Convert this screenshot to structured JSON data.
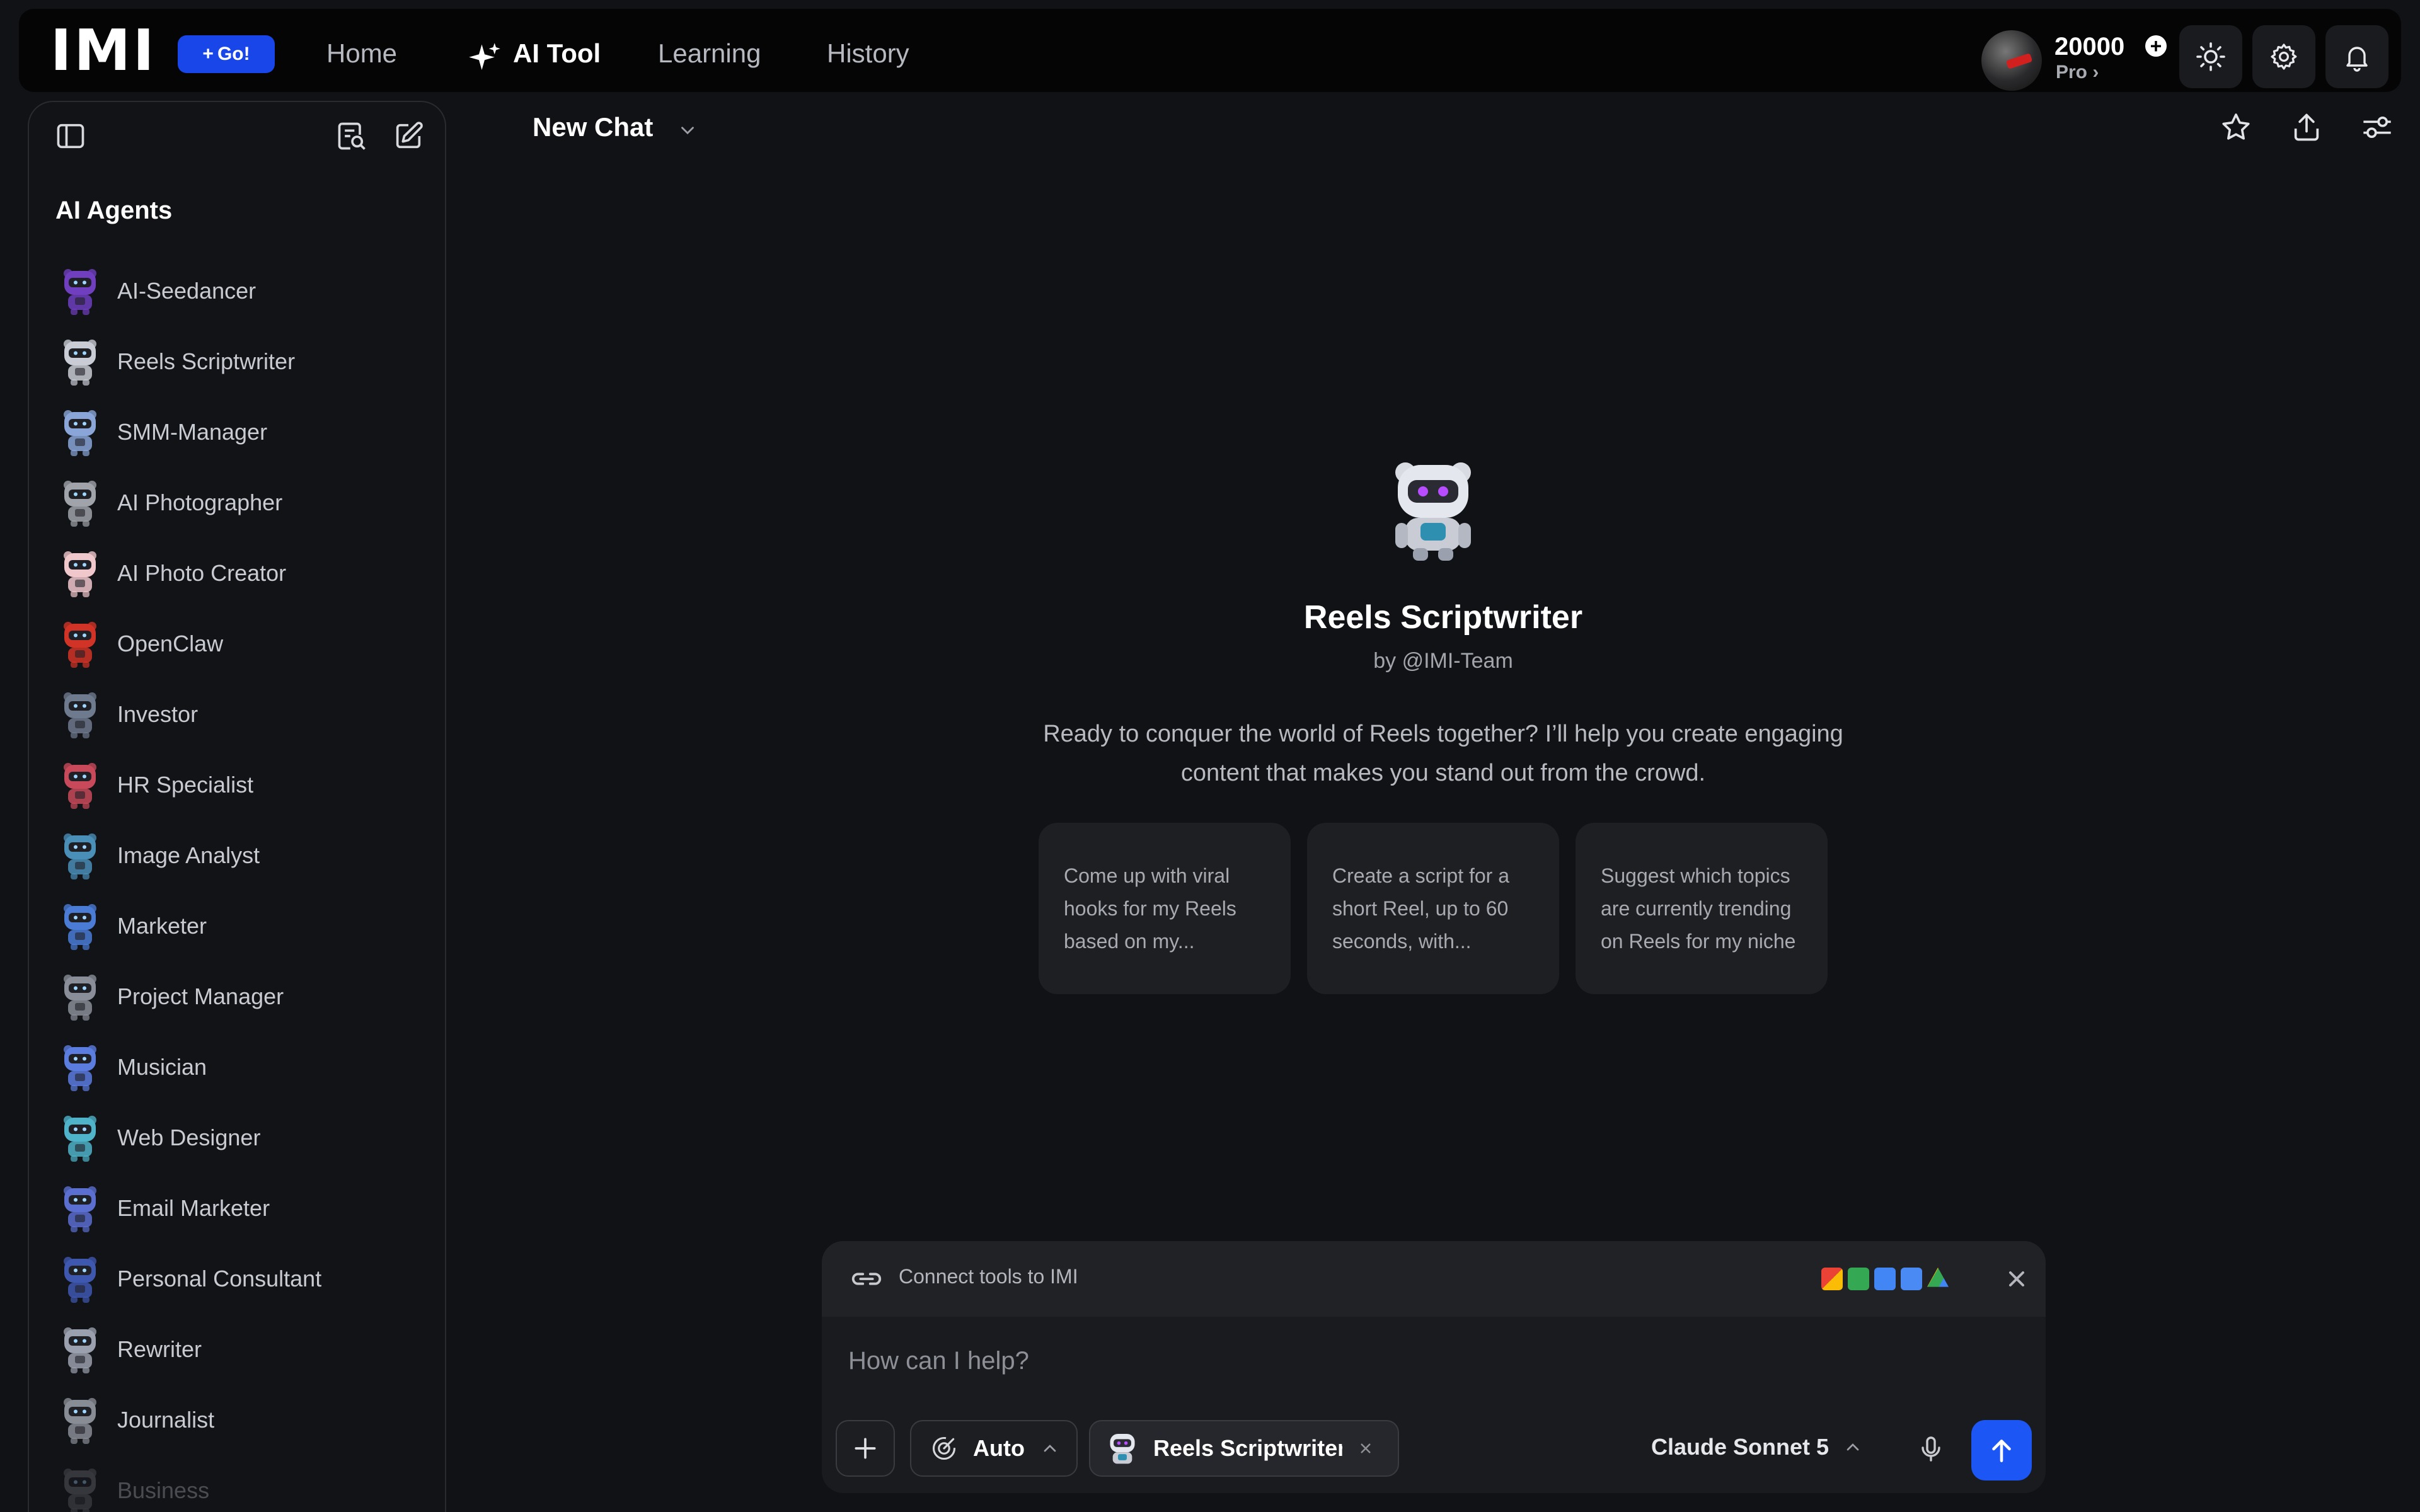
{
  "topbar": {
    "logo": "IMI",
    "go_badge": "Go!",
    "nav": [
      {
        "label": "Home"
      },
      {
        "label": "AI Tool"
      },
      {
        "label": "Learning"
      },
      {
        "label": "History"
      }
    ],
    "credits": {
      "amount": "20000",
      "plan": "Pro ›"
    },
    "icons": [
      "sun-icon",
      "gear-icon",
      "bell-icon"
    ]
  },
  "sidebar": {
    "heading": "AI Agents",
    "agents": [
      {
        "label": "AI-Seedancer",
        "color": "#6f3fbf"
      },
      {
        "label": "Reels Scriptwriter",
        "color": "#c9ccd4"
      },
      {
        "label": "SMM-Manager",
        "color": "#8aa6d8"
      },
      {
        "label": "AI Photographer",
        "color": "#a0a4aa"
      },
      {
        "label": "AI Photo Creator",
        "color": "#f0c8cc"
      },
      {
        "label": "OpenClaw",
        "color": "#d13427"
      },
      {
        "label": "Investor",
        "color": "#6e7a8e"
      },
      {
        "label": "HR Specialist",
        "color": "#c84a5a"
      },
      {
        "label": "Image Analyst",
        "color": "#4a8fb8"
      },
      {
        "label": "Marketer",
        "color": "#4a7cd6"
      },
      {
        "label": "Project Manager",
        "color": "#8a8e98"
      },
      {
        "label": "Musician",
        "color": "#5b7de0"
      },
      {
        "label": "Web Designer",
        "color": "#4fb3c9"
      },
      {
        "label": "Email Marketer",
        "color": "#5a6fd0"
      },
      {
        "label": "Personal Consultant",
        "color": "#3e58b0"
      },
      {
        "label": "Rewriter",
        "color": "#9aa0ad"
      },
      {
        "label": "Journalist",
        "color": "#888c94"
      },
      {
        "label": "Business",
        "color": "#777a82"
      }
    ]
  },
  "main": {
    "chat_title": "New Chat",
    "agent": {
      "name": "Reels Scriptwriter",
      "by": "by @IMI-Team",
      "description": "Ready to conquer the world of Reels together? I’ll help you create engaging content that makes you stand out from the crowd."
    },
    "suggestions": [
      "Come up with viral hooks for my Reels based on my...",
      "Create a script for a short Reel, up to 60 seconds, with...",
      "Suggest which topics are currently trending on Reels for my niche"
    ]
  },
  "composer": {
    "connect_text": "Connect tools to IMI",
    "placeholder": "How can I help?",
    "mode": "Auto",
    "agent_chip": "Reels Scriptwriter",
    "model": "Claude Sonnet 5"
  },
  "colors": {
    "accent": "#1c57f5",
    "background": "#111215",
    "topbar": "#050506"
  }
}
